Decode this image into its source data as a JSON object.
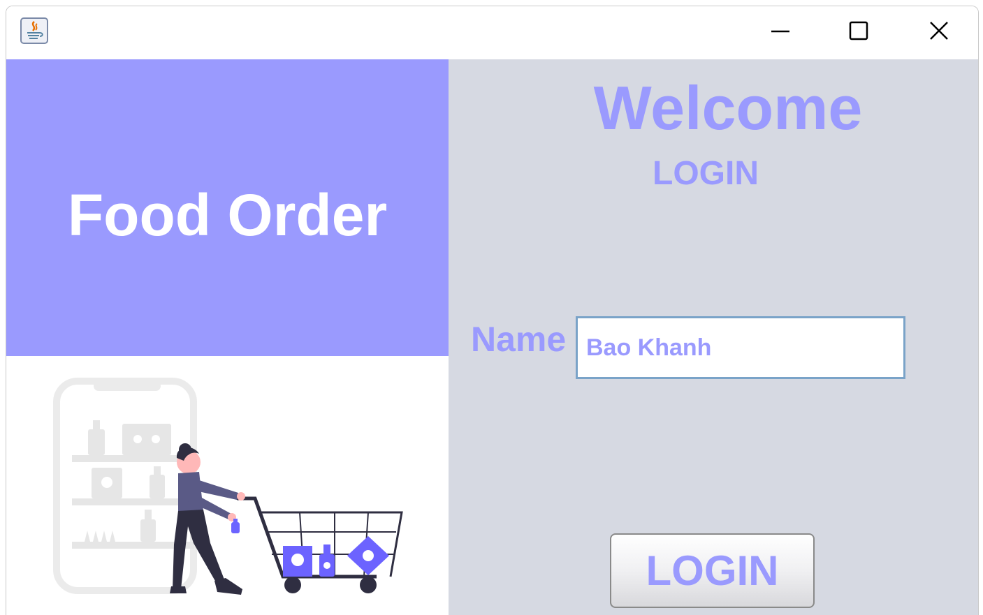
{
  "window": {
    "controls": {
      "minimize": "minimize-icon",
      "maximize": "maximize-icon",
      "close": "close-icon"
    }
  },
  "left": {
    "title": "Food Order",
    "illustration": "shopping-cart-illustration"
  },
  "login": {
    "welcome": "Welcome",
    "heading": "LOGIN",
    "name_label": "Name",
    "name_value": "Bao Khanh",
    "button_label": "LOGIN"
  },
  "colors": {
    "accent": "#9a9afe",
    "panel_bg": "#d6d9e2",
    "illustration_dark": "#2f2e41",
    "illustration_accent": "#6c63ff"
  }
}
